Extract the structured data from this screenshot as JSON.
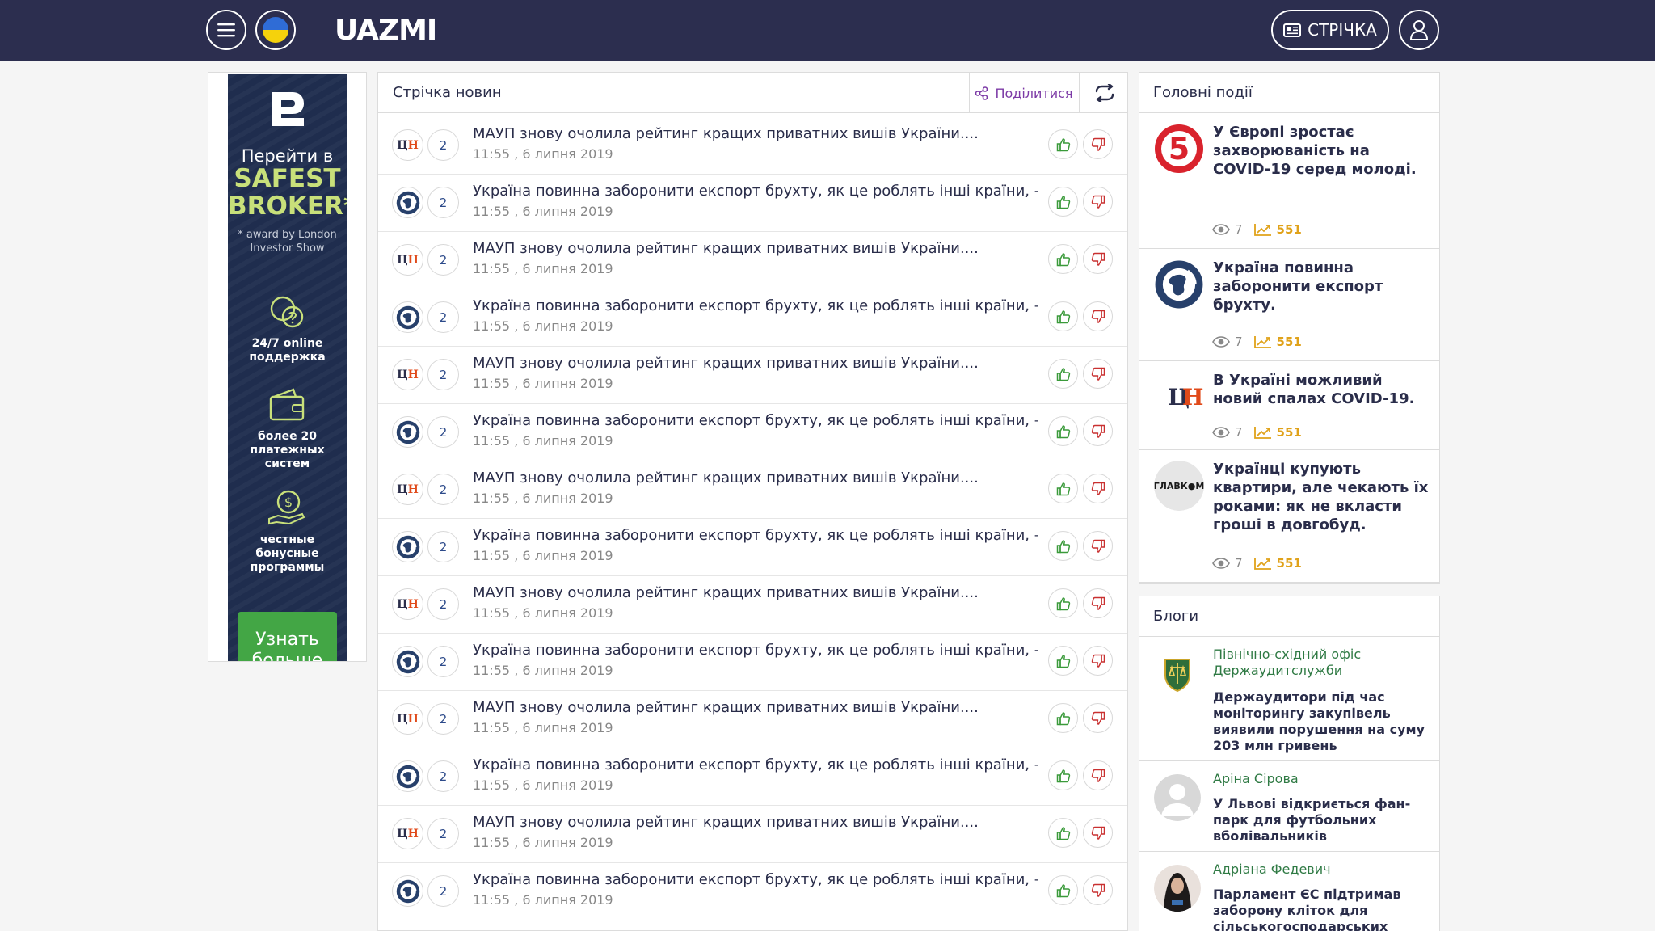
{
  "header": {
    "logo_text": "UAZMI",
    "feed_button_label": "СТРІЧКА"
  },
  "ad": {
    "goto": "Перейти в",
    "brand": "SAFEST BROKER*",
    "award": "* award by London Investor Show",
    "features": [
      {
        "icon": "chat-bubbles-icon",
        "label": "24/7 online поддержка"
      },
      {
        "icon": "wallet-icon",
        "label": "более 20 платежных систем"
      },
      {
        "icon": "coin-hand-icon",
        "label": "честные бонусные программы"
      }
    ],
    "cta": "Узнать больше"
  },
  "feed": {
    "title": "Стрічка новин",
    "share_label": "Поділитися",
    "items": [
      {
        "source": "cn",
        "count": "2",
        "title": "МАУП знову очолила рейтинг кращих приватних вишів України....",
        "date": "11:55 , 6 липня 2019"
      },
      {
        "source": "globe",
        "count": "2",
        "title": "Україна повинна заборонити експорт брухту, як це роблять інші країни, –...",
        "date": "11:55 , 6 липня 2019"
      },
      {
        "source": "cn",
        "count": "2",
        "title": "МАУП знову очолила рейтинг кращих приватних вишів України....",
        "date": "11:55 , 6 липня 2019"
      },
      {
        "source": "globe",
        "count": "2",
        "title": "Україна повинна заборонити експорт брухту, як це роблять інші країни, –...",
        "date": "11:55 , 6 липня 2019"
      },
      {
        "source": "cn",
        "count": "2",
        "title": "МАУП знову очолила рейтинг кращих приватних вишів України....",
        "date": "11:55 , 6 липня 2019"
      },
      {
        "source": "globe",
        "count": "2",
        "title": "Україна повинна заборонити експорт брухту, як це роблять інші країни, –...",
        "date": "11:55 , 6 липня 2019"
      },
      {
        "source": "cn",
        "count": "2",
        "title": "МАУП знову очолила рейтинг кращих приватних вишів України....",
        "date": "11:55 , 6 липня 2019"
      },
      {
        "source": "globe",
        "count": "2",
        "title": "Україна повинна заборонити експорт брухту, як це роблять інші країни, –...",
        "date": "11:55 , 6 липня 2019"
      },
      {
        "source": "cn",
        "count": "2",
        "title": "МАУП знову очолила рейтинг кращих приватних вишів України....",
        "date": "11:55 , 6 липня 2019"
      },
      {
        "source": "globe",
        "count": "2",
        "title": "Україна повинна заборонити експорт брухту, як це роблять інші країни, –...",
        "date": "11:55 , 6 липня 2019"
      },
      {
        "source": "cn",
        "count": "2",
        "title": "МАУП знову очолила рейтинг кращих приватних вишів України....",
        "date": "11:55 , 6 липня 2019"
      },
      {
        "source": "globe",
        "count": "2",
        "title": "Україна повинна заборонити експорт брухту, як це роблять інші країни, –...",
        "date": "11:55 , 6 липня 2019"
      },
      {
        "source": "cn",
        "count": "2",
        "title": "МАУП знову очолила рейтинг кращих приватних вишів України....",
        "date": "11:55 , 6 липня 2019"
      },
      {
        "source": "globe",
        "count": "2",
        "title": "Україна повинна заборонити експорт брухту, як це роблять інші країни, –...",
        "date": "11:55 , 6 липня 2019"
      }
    ]
  },
  "main_events": {
    "title": "Головні події",
    "items": [
      {
        "source": "five",
        "title": "У Європі зростає захворюваність на COVID-19 серед молоді.",
        "views": "7",
        "trend": "551"
      },
      {
        "source": "globe",
        "title": "Україна повинна заборонити експорт брухту.",
        "views": "7",
        "trend": "551"
      },
      {
        "source": "cn",
        "title": "В Україні можливий новий спалах COVID-19.",
        "views": "7",
        "trend": "551"
      },
      {
        "source": "glavcom",
        "title": "Українці купують квартири, але чекають їх роками: як не вкласти гроші в довгобуд.",
        "views": "7",
        "trend": "551"
      }
    ]
  },
  "blogs": {
    "title": "Блоги",
    "items": [
      {
        "avatar": "emblem",
        "author": "Північно-східний офіс Держаудитслужби",
        "title": "Держаудитори під час моніторингу закупівель виявили порушення на суму 203 млн гривень"
      },
      {
        "avatar": "placeholder",
        "author": "Аріна Сірова",
        "title": "У Львові відкриється фан-парк для футбольних вболівальників"
      },
      {
        "avatar": "photo",
        "author": "Адріана Федевич",
        "title": "Парламент ЄС підтримав заборону кліток для сільськогосподарських"
      }
    ]
  },
  "colors": {
    "header_bg": "#2c2e4f",
    "accent_green": "#2f7a44",
    "share_purple": "#7c3aa6",
    "trend_orange": "#e0a21a"
  }
}
